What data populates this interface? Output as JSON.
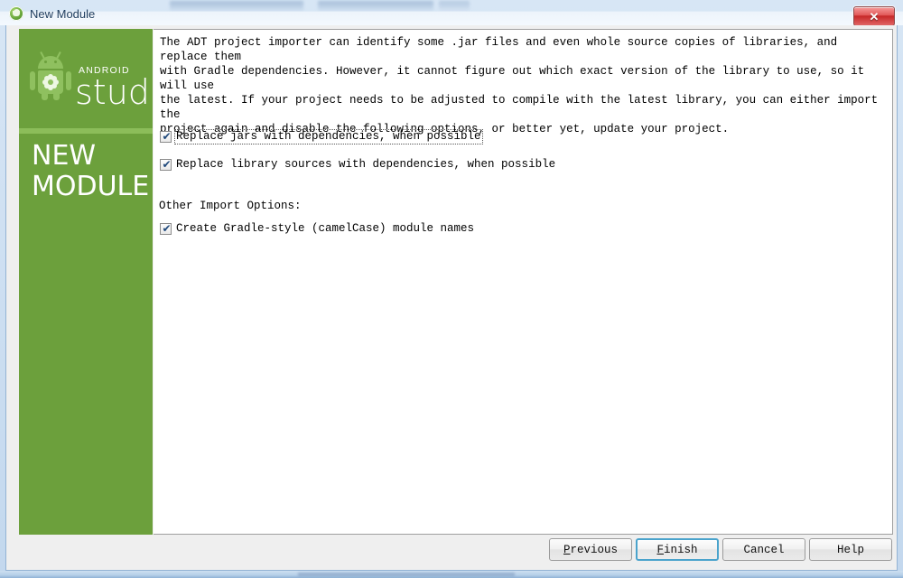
{
  "window": {
    "title": "New Module",
    "app_icon": "android-studio-icon",
    "close_label": "✕"
  },
  "banner": {
    "brand_small": "ANDROID",
    "brand_large": "studio",
    "title_line1": "NEW",
    "title_line2": "MODULE",
    "bg_color": "#6ca03c",
    "stripe_color": "#8cbd5a",
    "logo_color": "#8fc05f"
  },
  "content": {
    "intro_text": "The ADT project importer can identify some .jar files and even whole source copies of libraries, and replace them\nwith Gradle dependencies. However, it cannot figure out which exact version of the library to use, so it will use\nthe latest. If your project needs to be adjusted to compile with the latest library, you can either import the\nproject again and disable the following options, or better yet, update your project.",
    "options": [
      {
        "id": "replace-jars",
        "label": "Replace jars with dependencies, when possible",
        "checked": true,
        "focused": true
      },
      {
        "id": "replace-library-sources",
        "label": "Replace library sources with dependencies, when possible",
        "checked": true,
        "focused": false
      }
    ],
    "other_section_label": "Other Import Options:",
    "other_options": [
      {
        "id": "gradle-style-names",
        "label": "Create Gradle-style (camelCase) module names",
        "checked": true,
        "focused": false
      }
    ],
    "checkmark": "✔"
  },
  "footer": {
    "buttons": [
      {
        "id": "previous",
        "mnemonic": "P",
        "rest": "revious",
        "default": false
      },
      {
        "id": "finish",
        "mnemonic": "F",
        "rest": "inish",
        "default": true
      },
      {
        "id": "cancel",
        "mnemonic": "",
        "rest": "Cancel",
        "default": false
      },
      {
        "id": "help",
        "mnemonic": "",
        "rest": "Help",
        "default": false
      }
    ]
  },
  "colors": {
    "accent_green": "#6ca03c",
    "default_button_border": "#4aa3cc",
    "titlebar_text": "#1b3a5c",
    "close_red": "#c62727"
  }
}
